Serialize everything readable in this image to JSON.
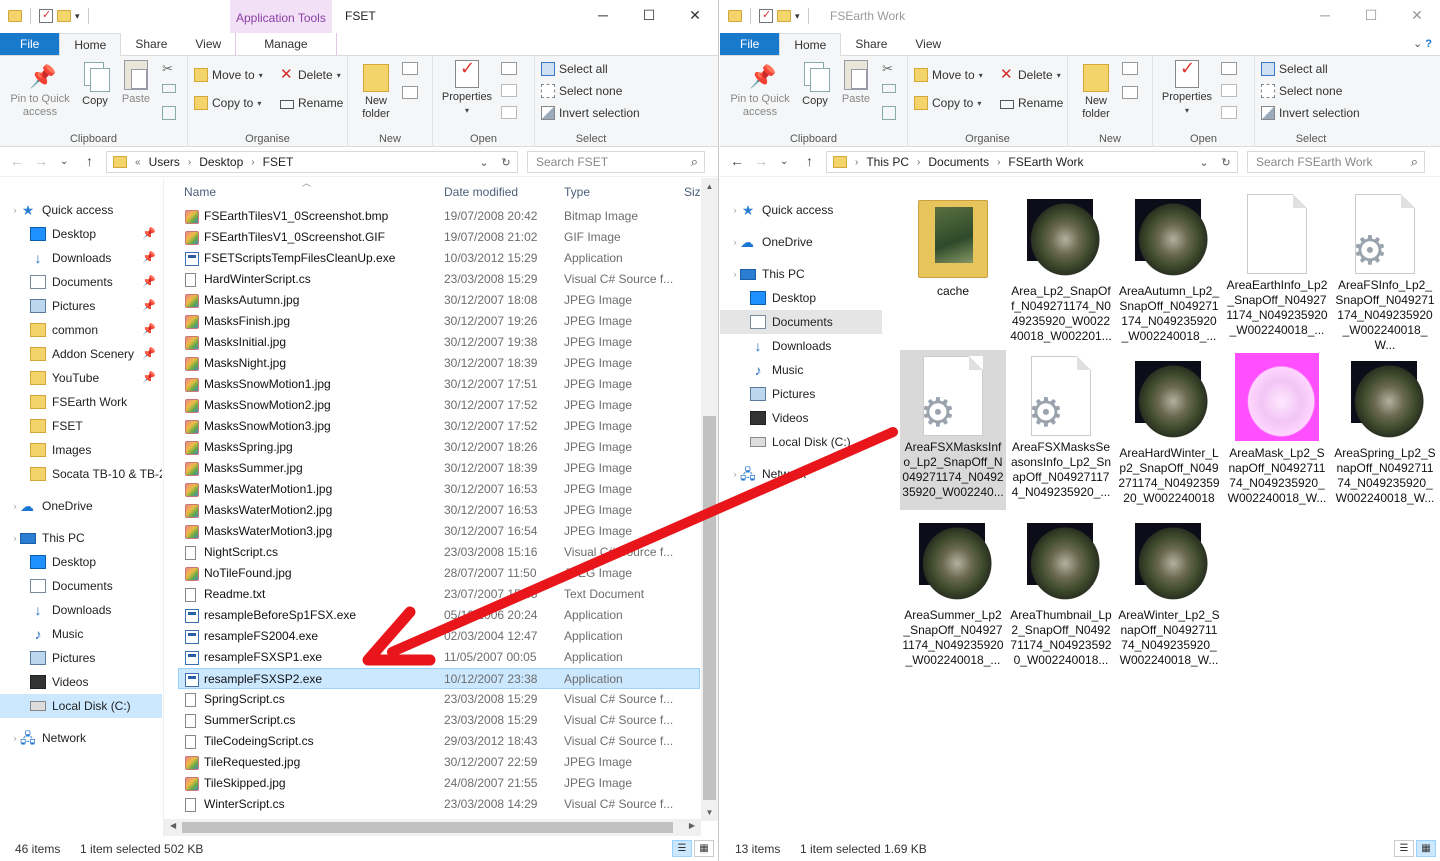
{
  "left": {
    "title": "FSET",
    "app_tools": "Application Tools",
    "tabs": {
      "file": "File",
      "home": "Home",
      "share": "Share",
      "view": "View",
      "manage": "Manage"
    },
    "ribbon": {
      "pin": "Pin to Quick\naccess",
      "copy": "Copy",
      "paste": "Paste",
      "move_to": "Move to",
      "copy_to": "Copy to",
      "delete": "Delete",
      "rename": "Rename",
      "new_folder": "New\nfolder",
      "properties": "Properties",
      "select_all": "Select all",
      "select_none": "Select none",
      "invert_selection": "Invert selection",
      "groups": {
        "clipboard": "Clipboard",
        "organise": "Organise",
        "new": "New",
        "open": "Open",
        "select": "Select"
      }
    },
    "address": {
      "prefix": "«",
      "crumbs": [
        "Users",
        "Desktop",
        "FSET"
      ]
    },
    "search_placeholder": "Search FSET",
    "nav": [
      {
        "label": "Quick access",
        "icon": "star-icon",
        "kind": "star",
        "level": 0
      },
      {
        "label": "Desktop",
        "icon": "desktop-icon",
        "kind": "desk",
        "level": 1,
        "pinned": true
      },
      {
        "label": "Downloads",
        "icon": "downloads-icon",
        "kind": "down",
        "level": 1,
        "pinned": true
      },
      {
        "label": "Documents",
        "icon": "documents-icon",
        "kind": "doc",
        "level": 1,
        "pinned": true
      },
      {
        "label": "Pictures",
        "icon": "pictures-icon",
        "kind": "pic",
        "level": 1,
        "pinned": true
      },
      {
        "label": "common",
        "icon": "folder-icon",
        "kind": "fold",
        "level": 1,
        "pinned": true
      },
      {
        "label": "Addon Scenery",
        "icon": "folder-icon",
        "kind": "fold",
        "level": 1,
        "pinned": true
      },
      {
        "label": "YouTube",
        "icon": "folder-icon",
        "kind": "fold",
        "level": 1,
        "pinned": true
      },
      {
        "label": "FSEarth Work",
        "icon": "folder-icon",
        "kind": "fold",
        "level": 1
      },
      {
        "label": "FSET",
        "icon": "folder-icon",
        "kind": "fold",
        "level": 1
      },
      {
        "label": "Images",
        "icon": "folder-icon",
        "kind": "fold",
        "level": 1
      },
      {
        "label": "Socata TB-10 & TB-2",
        "icon": "folder-icon",
        "kind": "fold",
        "level": 1
      },
      {
        "label": "",
        "kind": "gap"
      },
      {
        "label": "OneDrive",
        "icon": "onedrive-icon",
        "kind": "cloud",
        "level": 0
      },
      {
        "label": "",
        "kind": "gap"
      },
      {
        "label": "This PC",
        "icon": "this-pc-icon",
        "kind": "pc",
        "level": 0
      },
      {
        "label": "Desktop",
        "icon": "desktop-icon",
        "kind": "desk",
        "level": 1
      },
      {
        "label": "Documents",
        "icon": "documents-icon",
        "kind": "doc",
        "level": 1
      },
      {
        "label": "Downloads",
        "icon": "downloads-icon",
        "kind": "down",
        "level": 1
      },
      {
        "label": "Music",
        "icon": "music-icon",
        "kind": "music",
        "level": 1
      },
      {
        "label": "Pictures",
        "icon": "pictures-icon",
        "kind": "pic",
        "level": 1
      },
      {
        "label": "Videos",
        "icon": "videos-icon",
        "kind": "vid",
        "level": 1
      },
      {
        "label": "Local Disk (C:)",
        "icon": "local-disk-icon",
        "kind": "disk",
        "level": 1,
        "selected": true
      },
      {
        "label": "",
        "kind": "gap"
      },
      {
        "label": "Network",
        "icon": "network-icon",
        "kind": "net",
        "level": 0
      }
    ],
    "columns": {
      "name": "Name",
      "date": "Date modified",
      "type": "Type",
      "size": "Size"
    },
    "files": [
      {
        "name": "FSEarthTilesV1_0Screenshot.bmp",
        "date": "19/07/2008 20:42",
        "type": "Bitmap Image",
        "icon": "img"
      },
      {
        "name": "FSEarthTilesV1_0Screenshot.GIF",
        "date": "19/07/2008 21:02",
        "type": "GIF Image",
        "icon": "img"
      },
      {
        "name": "FSETScriptsTempFilesCleanUp.exe",
        "date": "10/03/2012 15:29",
        "type": "Application",
        "icon": "exe"
      },
      {
        "name": "HardWinterScript.cs",
        "date": "23/03/2008 15:29",
        "type": "Visual C# Source f...",
        "icon": "txt"
      },
      {
        "name": "MasksAutumn.jpg",
        "date": "30/12/2007 18:08",
        "type": "JPEG Image",
        "icon": "img"
      },
      {
        "name": "MasksFinish.jpg",
        "date": "30/12/2007 19:26",
        "type": "JPEG Image",
        "icon": "img"
      },
      {
        "name": "MasksInitial.jpg",
        "date": "30/12/2007 19:38",
        "type": "JPEG Image",
        "icon": "img"
      },
      {
        "name": "MasksNight.jpg",
        "date": "30/12/2007 18:39",
        "type": "JPEG Image",
        "icon": "img"
      },
      {
        "name": "MasksSnowMotion1.jpg",
        "date": "30/12/2007 17:51",
        "type": "JPEG Image",
        "icon": "img"
      },
      {
        "name": "MasksSnowMotion2.jpg",
        "date": "30/12/2007 17:52",
        "type": "JPEG Image",
        "icon": "img"
      },
      {
        "name": "MasksSnowMotion3.jpg",
        "date": "30/12/2007 17:52",
        "type": "JPEG Image",
        "icon": "img"
      },
      {
        "name": "MasksSpring.jpg",
        "date": "30/12/2007 18:26",
        "type": "JPEG Image",
        "icon": "img"
      },
      {
        "name": "MasksSummer.jpg",
        "date": "30/12/2007 18:39",
        "type": "JPEG Image",
        "icon": "img"
      },
      {
        "name": "MasksWaterMotion1.jpg",
        "date": "30/12/2007 16:53",
        "type": "JPEG Image",
        "icon": "img"
      },
      {
        "name": "MasksWaterMotion2.jpg",
        "date": "30/12/2007 16:53",
        "type": "JPEG Image",
        "icon": "img"
      },
      {
        "name": "MasksWaterMotion3.jpg",
        "date": "30/12/2007 16:54",
        "type": "JPEG Image",
        "icon": "img"
      },
      {
        "name": "NightScript.cs",
        "date": "23/03/2008 15:16",
        "type": "Visual C# Source f...",
        "icon": "txt"
      },
      {
        "name": "NoTileFound.jpg",
        "date": "28/07/2007 11:50",
        "type": "JPEG Image",
        "icon": "img"
      },
      {
        "name": "Readme.txt",
        "date": "23/07/2007 15:35",
        "type": "Text Document",
        "icon": "txt"
      },
      {
        "name": "resampleBeforeSp1FSX.exe",
        "date": "05/12/2006 20:24",
        "type": "Application",
        "icon": "exe"
      },
      {
        "name": "resampleFS2004.exe",
        "date": "02/03/2004 12:47",
        "type": "Application",
        "icon": "exe"
      },
      {
        "name": "resampleFSXSP1.exe",
        "date": "11/05/2007 00:05",
        "type": "Application",
        "icon": "exe"
      },
      {
        "name": "resampleFSXSP2.exe",
        "date": "10/12/2007 23:38",
        "type": "Application",
        "icon": "exe",
        "selected": true
      },
      {
        "name": "SpringScript.cs",
        "date": "23/03/2008 15:29",
        "type": "Visual C# Source f...",
        "icon": "txt"
      },
      {
        "name": "SummerScript.cs",
        "date": "23/03/2008 15:29",
        "type": "Visual C# Source f...",
        "icon": "txt"
      },
      {
        "name": "TileCodeingScript.cs",
        "date": "29/03/2012 18:43",
        "type": "Visual C# Source f...",
        "icon": "txt"
      },
      {
        "name": "TileRequested.jpg",
        "date": "30/12/2007 22:59",
        "type": "JPEG Image",
        "icon": "img"
      },
      {
        "name": "TileSkipped.jpg",
        "date": "24/08/2007 21:55",
        "type": "JPEG Image",
        "icon": "img"
      },
      {
        "name": "WinterScript.cs",
        "date": "23/03/2008 14:29",
        "type": "Visual C# Source f...",
        "icon": "txt"
      }
    ],
    "status": {
      "count": "46 items",
      "selected": "1 item selected  502 KB"
    }
  },
  "right": {
    "title": "FSEarth Work",
    "tabs": {
      "file": "File",
      "home": "Home",
      "share": "Share",
      "view": "View"
    },
    "ribbon": {
      "pin": "Pin to Quick\naccess",
      "copy": "Copy",
      "paste": "Paste",
      "move_to": "Move to",
      "copy_to": "Copy to",
      "delete": "Delete",
      "rename": "Rename",
      "new_folder": "New\nfolder",
      "properties": "Properties",
      "select_all": "Select all",
      "select_none": "Select none",
      "invert_selection": "Invert selection",
      "groups": {
        "clipboard": "Clipboard",
        "organise": "Organise",
        "new": "New",
        "open": "Open",
        "select": "Select"
      }
    },
    "address": {
      "crumbs": [
        "This PC",
        "Documents",
        "FSEarth Work"
      ]
    },
    "search_placeholder": "Search FSEarth Work",
    "nav": [
      {
        "label": "Quick access",
        "icon": "star-icon",
        "kind": "star",
        "level": 0
      },
      {
        "label": "",
        "kind": "gap-s"
      },
      {
        "label": "OneDrive",
        "icon": "onedrive-icon",
        "kind": "cloud",
        "level": 0
      },
      {
        "label": "",
        "kind": "gap-s"
      },
      {
        "label": "This PC",
        "icon": "this-pc-icon",
        "kind": "pc",
        "level": 0
      },
      {
        "label": "Desktop",
        "icon": "desktop-icon",
        "kind": "desk",
        "level": 1
      },
      {
        "label": "Documents",
        "icon": "documents-icon",
        "kind": "doc",
        "level": 1,
        "hover": true
      },
      {
        "label": "Downloads",
        "icon": "downloads-icon",
        "kind": "down",
        "level": 1
      },
      {
        "label": "Music",
        "icon": "music-icon",
        "kind": "music",
        "level": 1
      },
      {
        "label": "Pictures",
        "icon": "pictures-icon",
        "kind": "pic",
        "level": 1
      },
      {
        "label": "Videos",
        "icon": "videos-icon",
        "kind": "vid",
        "level": 1
      },
      {
        "label": "Local Disk (C:)",
        "icon": "local-disk-icon",
        "kind": "disk",
        "level": 1
      },
      {
        "label": "",
        "kind": "gap-s"
      },
      {
        "label": "Network",
        "icon": "network-icon",
        "kind": "net",
        "level": 0
      }
    ],
    "tiles": [
      {
        "label": "cache",
        "thumb": "folder"
      },
      {
        "label": "Area_Lp2_SnapOff_N049271174_N049235920_W002240018_W002201...",
        "thumb": "sat"
      },
      {
        "label": "AreaAutumn_Lp2_SnapOff_N049271174_N049235920_W002240018_...",
        "thumb": "sat"
      },
      {
        "label": "AreaEarthInfo_Lp2_SnapOff_N049271174_N049235920_W002240018_...",
        "thumb": "doc"
      },
      {
        "label": "AreaFSInfo_Lp2_SnapOff_N049271174_N049235920_W002240018_W...",
        "thumb": "gear"
      },
      {
        "label": "AreaFSXMasksInfo_Lp2_SnapOff_N049271174_N049235920_W002240...",
        "thumb": "gear",
        "selected": true
      },
      {
        "label": "AreaFSXMasksSeasonsInfo_Lp2_SnapOff_N049271174_N049235920_...",
        "thumb": "gear"
      },
      {
        "label": "AreaHardWinter_Lp2_SnapOff_N049271174_N049235920_W002240018_...",
        "thumb": "sat"
      },
      {
        "label": "AreaMask_Lp2_SnapOff_N049271174_N049235920_W002240018_W...",
        "thumb": "mask"
      },
      {
        "label": "AreaSpring_Lp2_SnapOff_N049271174_N049235920_W002240018_W...",
        "thumb": "sat"
      },
      {
        "label": "AreaSummer_Lp2_SnapOff_N049271174_N049235920_W002240018_...",
        "thumb": "sat"
      },
      {
        "label": "AreaThumbnail_Lp2_SnapOff_N049271174_N049235920_W002240018...",
        "thumb": "sat"
      },
      {
        "label": "AreaWinter_Lp2_SnapOff_N049271174_N049235920_W002240018_W...",
        "thumb": "sat"
      }
    ],
    "status": {
      "count": "13 items",
      "selected": "1 item selected  1.69 KB"
    }
  },
  "colors": {
    "accent": "#1979ca",
    "selection": "#cce8ff",
    "arrow": "#e8151b",
    "app_tools": "#f2e0f7"
  }
}
